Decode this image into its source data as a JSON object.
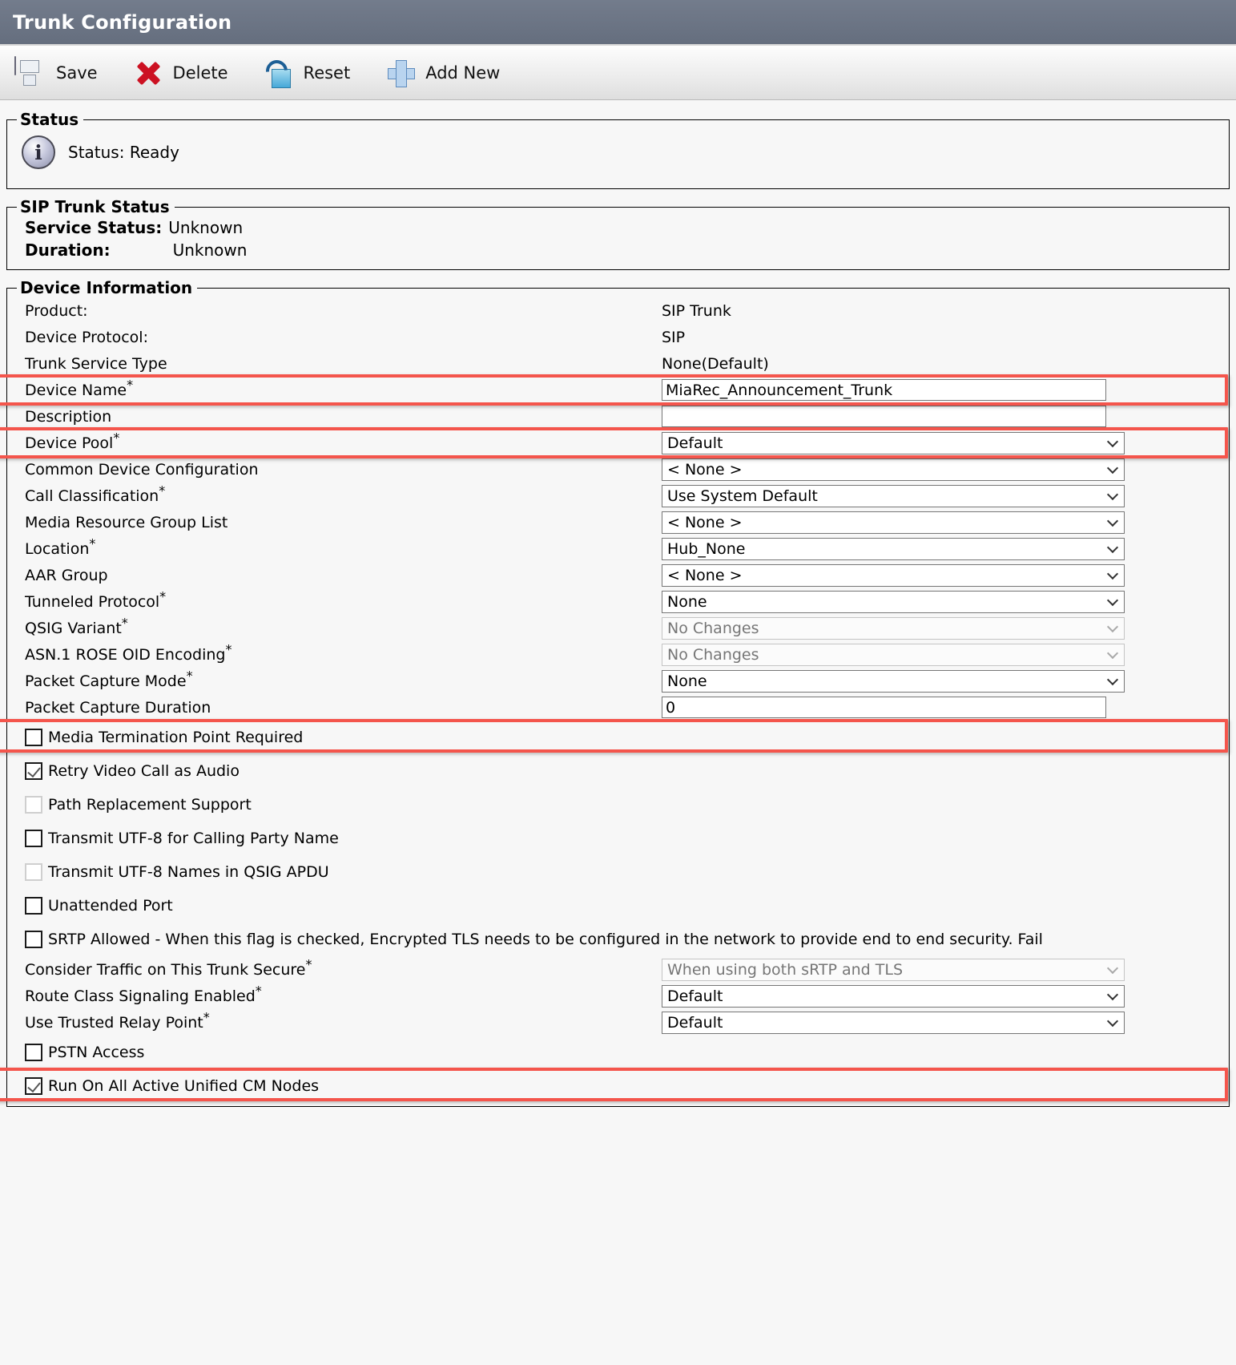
{
  "window": {
    "title": "Trunk Configuration"
  },
  "toolbar": {
    "save_label": "Save",
    "delete_label": "Delete",
    "reset_label": "Reset",
    "add_new_label": "Add New"
  },
  "status_panel": {
    "legend": "Status",
    "icon": "info-icon",
    "message": "Status: Ready"
  },
  "sip_trunk_status": {
    "legend": "SIP Trunk Status",
    "service_status_label": "Service Status:",
    "service_status_value": "Unknown",
    "duration_label": "Duration:",
    "duration_value": "Unknown"
  },
  "device_information": {
    "legend": "Device Information",
    "static_rows": [
      {
        "label": "Product:",
        "value": "SIP Trunk"
      },
      {
        "label": "Device Protocol:",
        "value": "SIP"
      },
      {
        "label": "Trunk Service Type",
        "value": "None(Default)"
      }
    ],
    "device_name": {
      "label": "Device Name",
      "required": "*",
      "value": "MiaRec_Announcement_Trunk"
    },
    "description": {
      "label": "Description",
      "value": ""
    },
    "selects": [
      {
        "label": "Device Pool",
        "required": "*",
        "value": "Default",
        "disabled": false
      },
      {
        "label": "Common Device Configuration",
        "required": "",
        "value": "< None >",
        "disabled": false
      },
      {
        "label": "Call Classification",
        "required": "*",
        "value": "Use System Default",
        "disabled": false
      },
      {
        "label": "Media Resource Group List",
        "required": "",
        "value": "< None >",
        "disabled": false
      },
      {
        "label": "Location",
        "required": "*",
        "value": "Hub_None",
        "disabled": false
      },
      {
        "label": "AAR Group",
        "required": "",
        "value": "< None >",
        "disabled": false
      },
      {
        "label": "Tunneled Protocol",
        "required": "*",
        "value": "None",
        "disabled": false
      },
      {
        "label": "QSIG Variant",
        "required": "*",
        "value": "No Changes",
        "disabled": true
      },
      {
        "label": "ASN.1 ROSE OID Encoding",
        "required": "*",
        "value": "No Changes",
        "disabled": true
      },
      {
        "label": "Packet Capture Mode",
        "required": "*",
        "value": "None",
        "disabled": false
      }
    ],
    "packet_capture_duration": {
      "label": "Packet Capture Duration",
      "value": "0"
    },
    "checkboxes_top": [
      {
        "label": "Media Termination Point Required",
        "checked": false,
        "disabled": false,
        "highlighted": true
      },
      {
        "label": "Retry Video Call as Audio",
        "checked": true,
        "disabled": false,
        "highlighted": false
      },
      {
        "label": "Path Replacement Support",
        "checked": false,
        "disabled": true,
        "highlighted": false
      },
      {
        "label": "Transmit UTF-8 for Calling Party Name",
        "checked": false,
        "disabled": false,
        "highlighted": false
      },
      {
        "label": "Transmit UTF-8 Names in QSIG APDU",
        "checked": false,
        "disabled": true,
        "highlighted": false
      },
      {
        "label": "Unattended Port",
        "checked": false,
        "disabled": false,
        "highlighted": false
      },
      {
        "label": "SRTP Allowed - When this flag is checked, Encrypted TLS needs to be configured in the network to provide end to end security. Fail",
        "checked": false,
        "disabled": false,
        "highlighted": false
      }
    ],
    "selects_bottom": [
      {
        "label": "Consider Traffic on This Trunk Secure",
        "required": "*",
        "value": "When using both sRTP and TLS",
        "disabled": true
      },
      {
        "label": "Route Class Signaling Enabled",
        "required": "*",
        "value": "Default",
        "disabled": false
      },
      {
        "label": "Use Trusted Relay Point",
        "required": "*",
        "value": "Default",
        "disabled": false
      }
    ],
    "checkboxes_bottom": [
      {
        "label": "PSTN Access",
        "checked": false,
        "disabled": false,
        "highlighted": false
      },
      {
        "label": "Run On All Active Unified CM Nodes",
        "checked": true,
        "disabled": false,
        "highlighted": true
      }
    ]
  },
  "colors": {
    "titlebar": "#6a7384",
    "highlight": "#f4554c",
    "page_bg": "#f7f7f7"
  }
}
